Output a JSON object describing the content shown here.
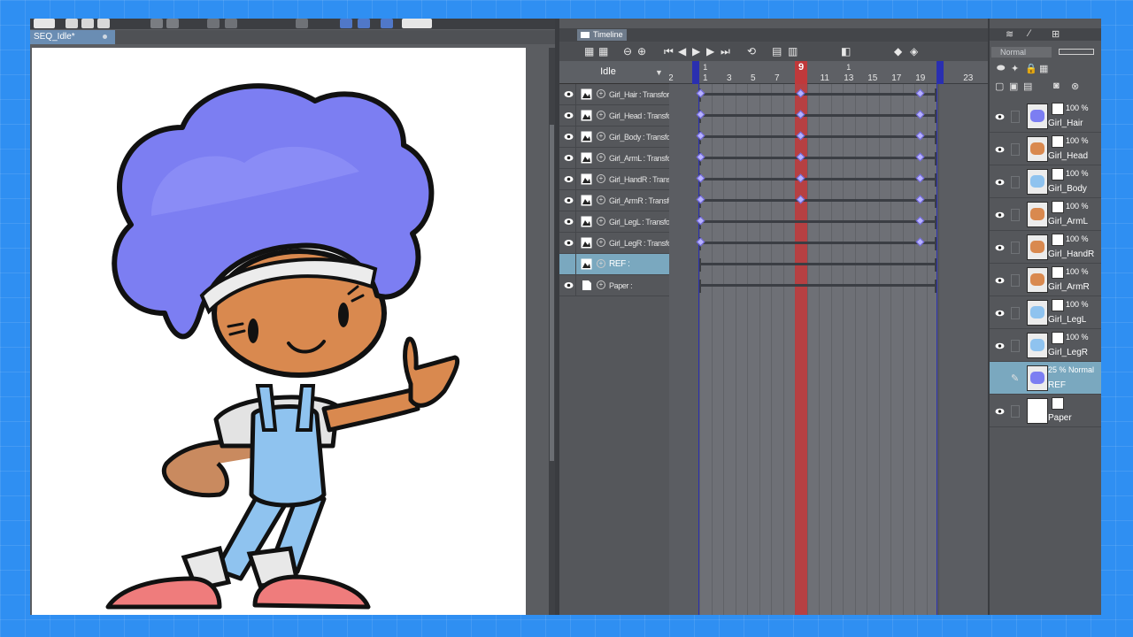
{
  "document": {
    "tab_label": "SEQ_Idle*"
  },
  "timeline": {
    "tab_label": "Timeline",
    "track_name": "Idle",
    "current_frame": "9",
    "ruler_ticks": [
      "-2",
      "1",
      "3",
      "5",
      "7",
      "9",
      "11",
      "13",
      "15",
      "17",
      "19",
      "23"
    ],
    "ruler_marks": [
      "1",
      "9",
      "1"
    ],
    "layers": [
      {
        "name": "Girl_Hair : Transform",
        "thumb": "image",
        "keys": [
          1,
          9,
          19
        ]
      },
      {
        "name": "Girl_Head : Transform",
        "thumb": "image",
        "keys": [
          1,
          9,
          19
        ]
      },
      {
        "name": "Girl_Body : Transform",
        "thumb": "image",
        "keys": [
          1,
          9,
          19
        ]
      },
      {
        "name": "Girl_ArmL : Transform",
        "thumb": "image",
        "keys": [
          1,
          9,
          19
        ]
      },
      {
        "name": "Girl_HandR : Transform",
        "thumb": "image",
        "keys": [
          1,
          9,
          19
        ]
      },
      {
        "name": "Girl_ArmR : Transform",
        "thumb": "image",
        "keys": [
          1,
          9,
          19
        ]
      },
      {
        "name": "Girl_LegL : Transform",
        "thumb": "image",
        "keys": [
          1,
          19
        ]
      },
      {
        "name": "Girl_LegR : Transform",
        "thumb": "image",
        "keys": [
          1,
          19
        ]
      },
      {
        "name": "REF :",
        "thumb": "image",
        "keys": [],
        "selected": true
      },
      {
        "name": "Paper :",
        "thumb": "paper",
        "keys": []
      }
    ]
  },
  "layer_palette": {
    "blend_mode": "Normal",
    "layers": [
      {
        "name": "Girl_Hair",
        "opacity": "100 %",
        "thumb_color": "#7c7ef2"
      },
      {
        "name": "Girl_Head",
        "opacity": "100 %",
        "thumb_color": "#d9894f"
      },
      {
        "name": "Girl_Body",
        "opacity": "100 %",
        "thumb_color": "#8fc3ef"
      },
      {
        "name": "Girl_ArmL",
        "opacity": "100 %",
        "thumb_color": "#d9894f"
      },
      {
        "name": "Girl_HandR",
        "opacity": "100 %",
        "thumb_color": "#d9894f"
      },
      {
        "name": "Girl_ArmR",
        "opacity": "100 %",
        "thumb_color": "#d9894f"
      },
      {
        "name": "Girl_LegL",
        "opacity": "100 %",
        "thumb_color": "#8fc3ef"
      },
      {
        "name": "Girl_LegR",
        "opacity": "100 %",
        "thumb_color": "#8fc3ef"
      },
      {
        "name": "REF",
        "opacity": "25 % Normal",
        "thumb_color": "#7c7ef2",
        "selected": true
      },
      {
        "name": "Paper",
        "opacity": "",
        "thumb_color": "#ffffff"
      }
    ]
  },
  "colors": {
    "background": "#2f8ff2",
    "keyframe": "#b7b2ff",
    "playhead": "#c0393b",
    "selection": "#7aa8bf",
    "hair": "#7c7ef2",
    "skin": "#d9894f",
    "overalls": "#8fc3ef",
    "shoes": "#ef7c7c"
  }
}
